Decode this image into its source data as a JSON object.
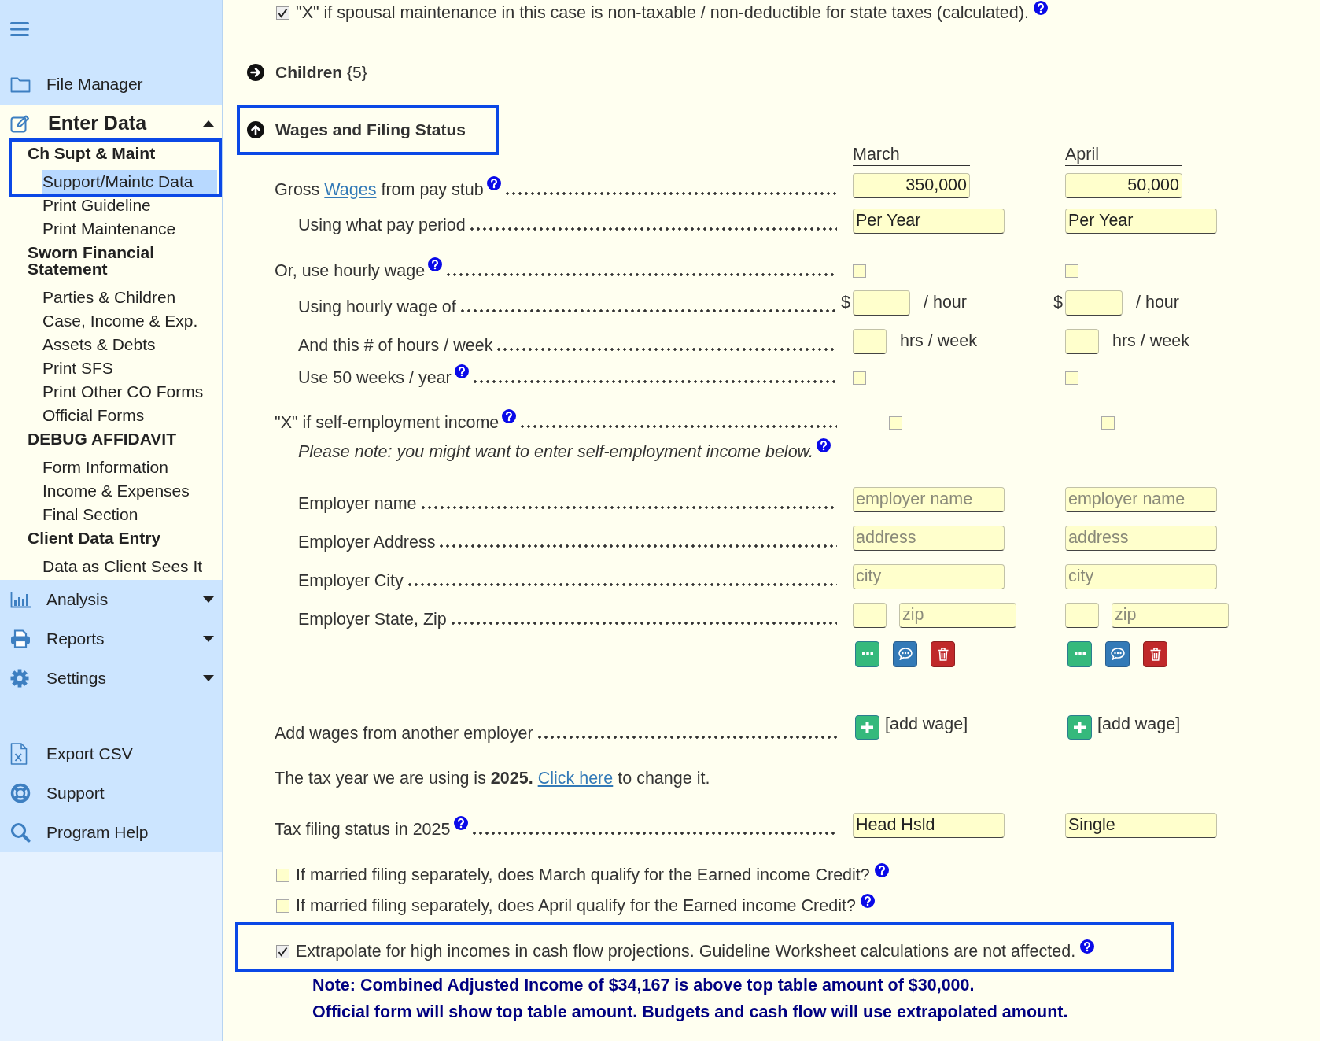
{
  "sidebar": {
    "top_items": [
      {
        "label": "File Manager"
      }
    ],
    "sections": [
      {
        "label": "Enter Data",
        "expanded": true,
        "entries": [
          {
            "kind": "heading",
            "label": "Ch Supt & Maint",
            "highlighted": true
          },
          {
            "kind": "link",
            "label": "Support/Maintc Data",
            "selected": true,
            "highlighted": true
          },
          {
            "kind": "link",
            "label": "Print Guideline",
            "selected": false,
            "highlighted": false
          },
          {
            "kind": "link",
            "label": "Print Maintenance",
            "selected": false,
            "highlighted": false
          },
          {
            "kind": "heading",
            "label": "Sworn Financial Statement",
            "highlighted": false
          },
          {
            "kind": "link",
            "label": "Parties & Children",
            "selected": false,
            "highlighted": false
          },
          {
            "kind": "link",
            "label": "Case, Income & Exp.",
            "selected": false,
            "highlighted": false
          },
          {
            "kind": "link",
            "label": "Assets & Debts",
            "selected": false,
            "highlighted": false
          },
          {
            "kind": "link",
            "label": "Print SFS",
            "selected": false,
            "highlighted": false
          },
          {
            "kind": "link",
            "label": "Print Other CO Forms",
            "selected": false,
            "highlighted": false
          },
          {
            "kind": "link",
            "label": "Official Forms",
            "selected": false,
            "highlighted": false
          },
          {
            "kind": "heading",
            "label": "DEBUG AFFIDAVIT",
            "highlighted": false
          },
          {
            "kind": "link",
            "label": "Form Information",
            "selected": false,
            "highlighted": false
          },
          {
            "kind": "link",
            "label": "Income & Expenses",
            "selected": false,
            "highlighted": false
          },
          {
            "kind": "link",
            "label": "Final Section",
            "selected": false,
            "highlighted": false
          },
          {
            "kind": "heading",
            "label": "Client Data Entry",
            "highlighted": false
          },
          {
            "kind": "link",
            "label": "Data as Client Sees It",
            "selected": false,
            "highlighted": false
          }
        ]
      },
      {
        "label": "Analysis",
        "expanded": false
      },
      {
        "label": "Reports",
        "expanded": false
      },
      {
        "label": "Settings",
        "expanded": false
      }
    ],
    "bottom_items": [
      {
        "label": "Export CSV"
      },
      {
        "label": "Support"
      },
      {
        "label": "Program Help"
      }
    ]
  },
  "form": {
    "top_checkbox": {
      "label": "\"X\" if spousal maintenance in this case is non-taxable / non-deductible for state taxes (calculated).",
      "checked": true,
      "help": true
    },
    "sections": [
      {
        "title": "Children",
        "count": "{5}",
        "expanded": false,
        "highlighted": false
      },
      {
        "title": "Wages and Filing Status",
        "expanded": true,
        "highlighted": true,
        "columns": [
          "March",
          "April"
        ],
        "questions": [
          {
            "kind": "amount",
            "label": "Gross",
            "link": "Wages",
            "label_end": "from pay stub",
            "help": true,
            "cells": [
              {
                "value": "350,000"
              },
              {
                "value": "50,000"
              }
            ],
            "children": [
              {
                "kind": "select",
                "label": "Using what pay period",
                "help": false,
                "cells": [
                  {
                    "value": "Per Year"
                  },
                  {
                    "value": "Per Year"
                  }
                ]
              }
            ]
          },
          {
            "kind": "checkbox",
            "label": "Or, use hourly wage",
            "help": true,
            "cells": [
              {
                "checked": false
              },
              {
                "checked": false
              }
            ],
            "children": [
              {
                "kind": "rate",
                "label": "Using hourly wage of",
                "help": false,
                "cells": [
                  {
                    "prefix": "$",
                    "unit": "/ hour"
                  },
                  {
                    "prefix": "$",
                    "unit": "/ hour"
                  }
                ]
              },
              {
                "kind": "hours",
                "label": "And this # of hours / week",
                "help": false,
                "cells": [
                  {
                    "unit": "hrs / week"
                  },
                  {
                    "unit": "hrs / week"
                  }
                ]
              },
              {
                "kind": "checkbox",
                "label": "Use 50 weeks / year",
                "help": true,
                "cells": [
                  {
                    "checked": false
                  },
                  {
                    "checked": false
                  }
                ]
              }
            ]
          },
          {
            "kind": "flag",
            "label": "\"X\" if self-employment income",
            "help": true,
            "cells": [
              {
                "checked": false
              },
              {
                "checked": false
              }
            ],
            "children": [
              {
                "kind": "note",
                "label": "Please note: you might want to enter self-employment income below.",
                "help": true
              }
            ]
          }
        ],
        "employer": {
          "fields": [
            {
              "kind": "text",
              "label": "Employer name",
              "cells": [
                {
                  "placeholder": "employer name"
                },
                {
                  "placeholder": "employer name"
                }
              ]
            },
            {
              "kind": "text",
              "label": "Employer Address",
              "cells": [
                {
                  "placeholder": "address"
                },
                {
                  "placeholder": "address"
                }
              ]
            },
            {
              "kind": "text",
              "label": "Employer City",
              "cells": [
                {
                  "placeholder": "city"
                },
                {
                  "placeholder": "city"
                }
              ]
            },
            {
              "kind": "state_zip",
              "label": "Employer State, Zip",
              "cells": [
                {
                  "placeholder": "zip"
                },
                {
                  "placeholder": "zip"
                }
              ]
            }
          ]
        },
        "add_wages": {
          "label": "Add wages from another employer",
          "buttons": [
            "[add wage]",
            "[add wage]"
          ]
        },
        "tax_year": {
          "text": "The tax year we are using is **2025.**",
          "link": "Click here",
          "text_end": "to change it."
        },
        "filing_status": {
          "label": "Tax filing status in 2025",
          "help": true,
          "values": [
            "Head Hsld",
            "Single"
          ]
        },
        "eic_questions": [
          {
            "label": "If married filing separately, does March qualify for the Earned income Credit?",
            "checked": false,
            "help": true
          },
          {
            "label": "If married filing separately, does April qualify for the Earned income Credit?",
            "checked": false,
            "help": true
          }
        ],
        "extrapolate": {
          "label": "Extrapolate for high incomes in cash flow projections. Guideline Worksheet calculations are not affected.",
          "checked": true,
          "help": true,
          "highlighted": true
        },
        "notes": [
          "Note: Combined Adjusted Income of $34,167 is above top table amount of $30,000.",
          "Official form will show top table amount. Budgets and cash flow will use extrapolated amount."
        ]
      }
    ]
  }
}
